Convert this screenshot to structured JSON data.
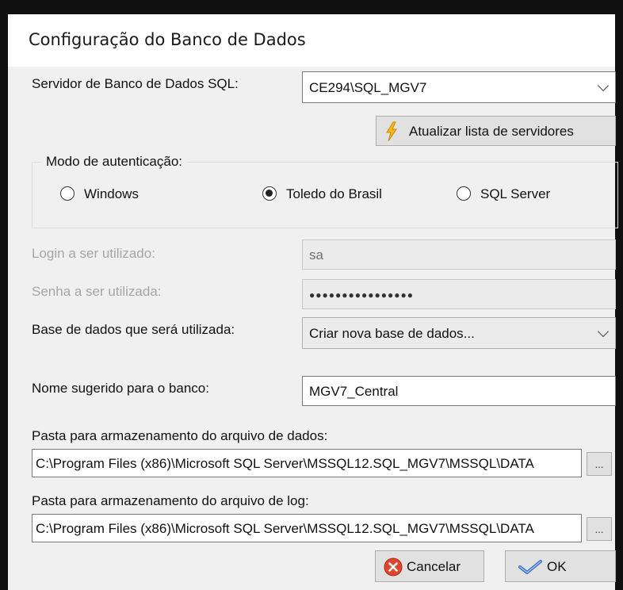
{
  "window": {
    "title": "Configuração do Banco de Dados"
  },
  "server": {
    "label": "Servidor de Banco de Dados SQL:",
    "value": "CE294\\SQL_MGV7",
    "refresh_button": "Atualizar lista de servidores"
  },
  "auth": {
    "group_label": "Modo de autenticação:",
    "options": [
      {
        "label": "Windows",
        "selected": false
      },
      {
        "label": "Toledo do Brasil",
        "selected": true
      },
      {
        "label": "SQL Server",
        "selected": false
      }
    ]
  },
  "login": {
    "label": "Login a ser utilizado:",
    "value": "sa"
  },
  "password": {
    "label": "Senha a ser utilizada:",
    "value": "●●●●●●●●●●●●●●●●"
  },
  "database": {
    "label": "Base de dados que será utilizada:",
    "value": "Criar nova base de dados..."
  },
  "db_name": {
    "label": "Nome sugerido para o banco:",
    "value": "MGV7_Central"
  },
  "data_folder": {
    "label": "Pasta para armazenamento do arquivo de dados:",
    "value": "C:\\Program Files (x86)\\Microsoft SQL Server\\MSSQL12.SQL_MGV7\\MSSQL\\DATA",
    "browse_label": "..."
  },
  "log_folder": {
    "label": "Pasta para armazenamento do arquivo de log:",
    "value": "C:\\Program Files (x86)\\Microsoft SQL Server\\MSSQL12.SQL_MGV7\\MSSQL\\DATA",
    "browse_label": "..."
  },
  "buttons": {
    "cancel": "Cancelar",
    "ok": "OK"
  },
  "colors": {
    "cancel_icon": "#e0452e",
    "ok_icon": "#3c6fc4",
    "lightning_icon": "#f4b81c"
  }
}
